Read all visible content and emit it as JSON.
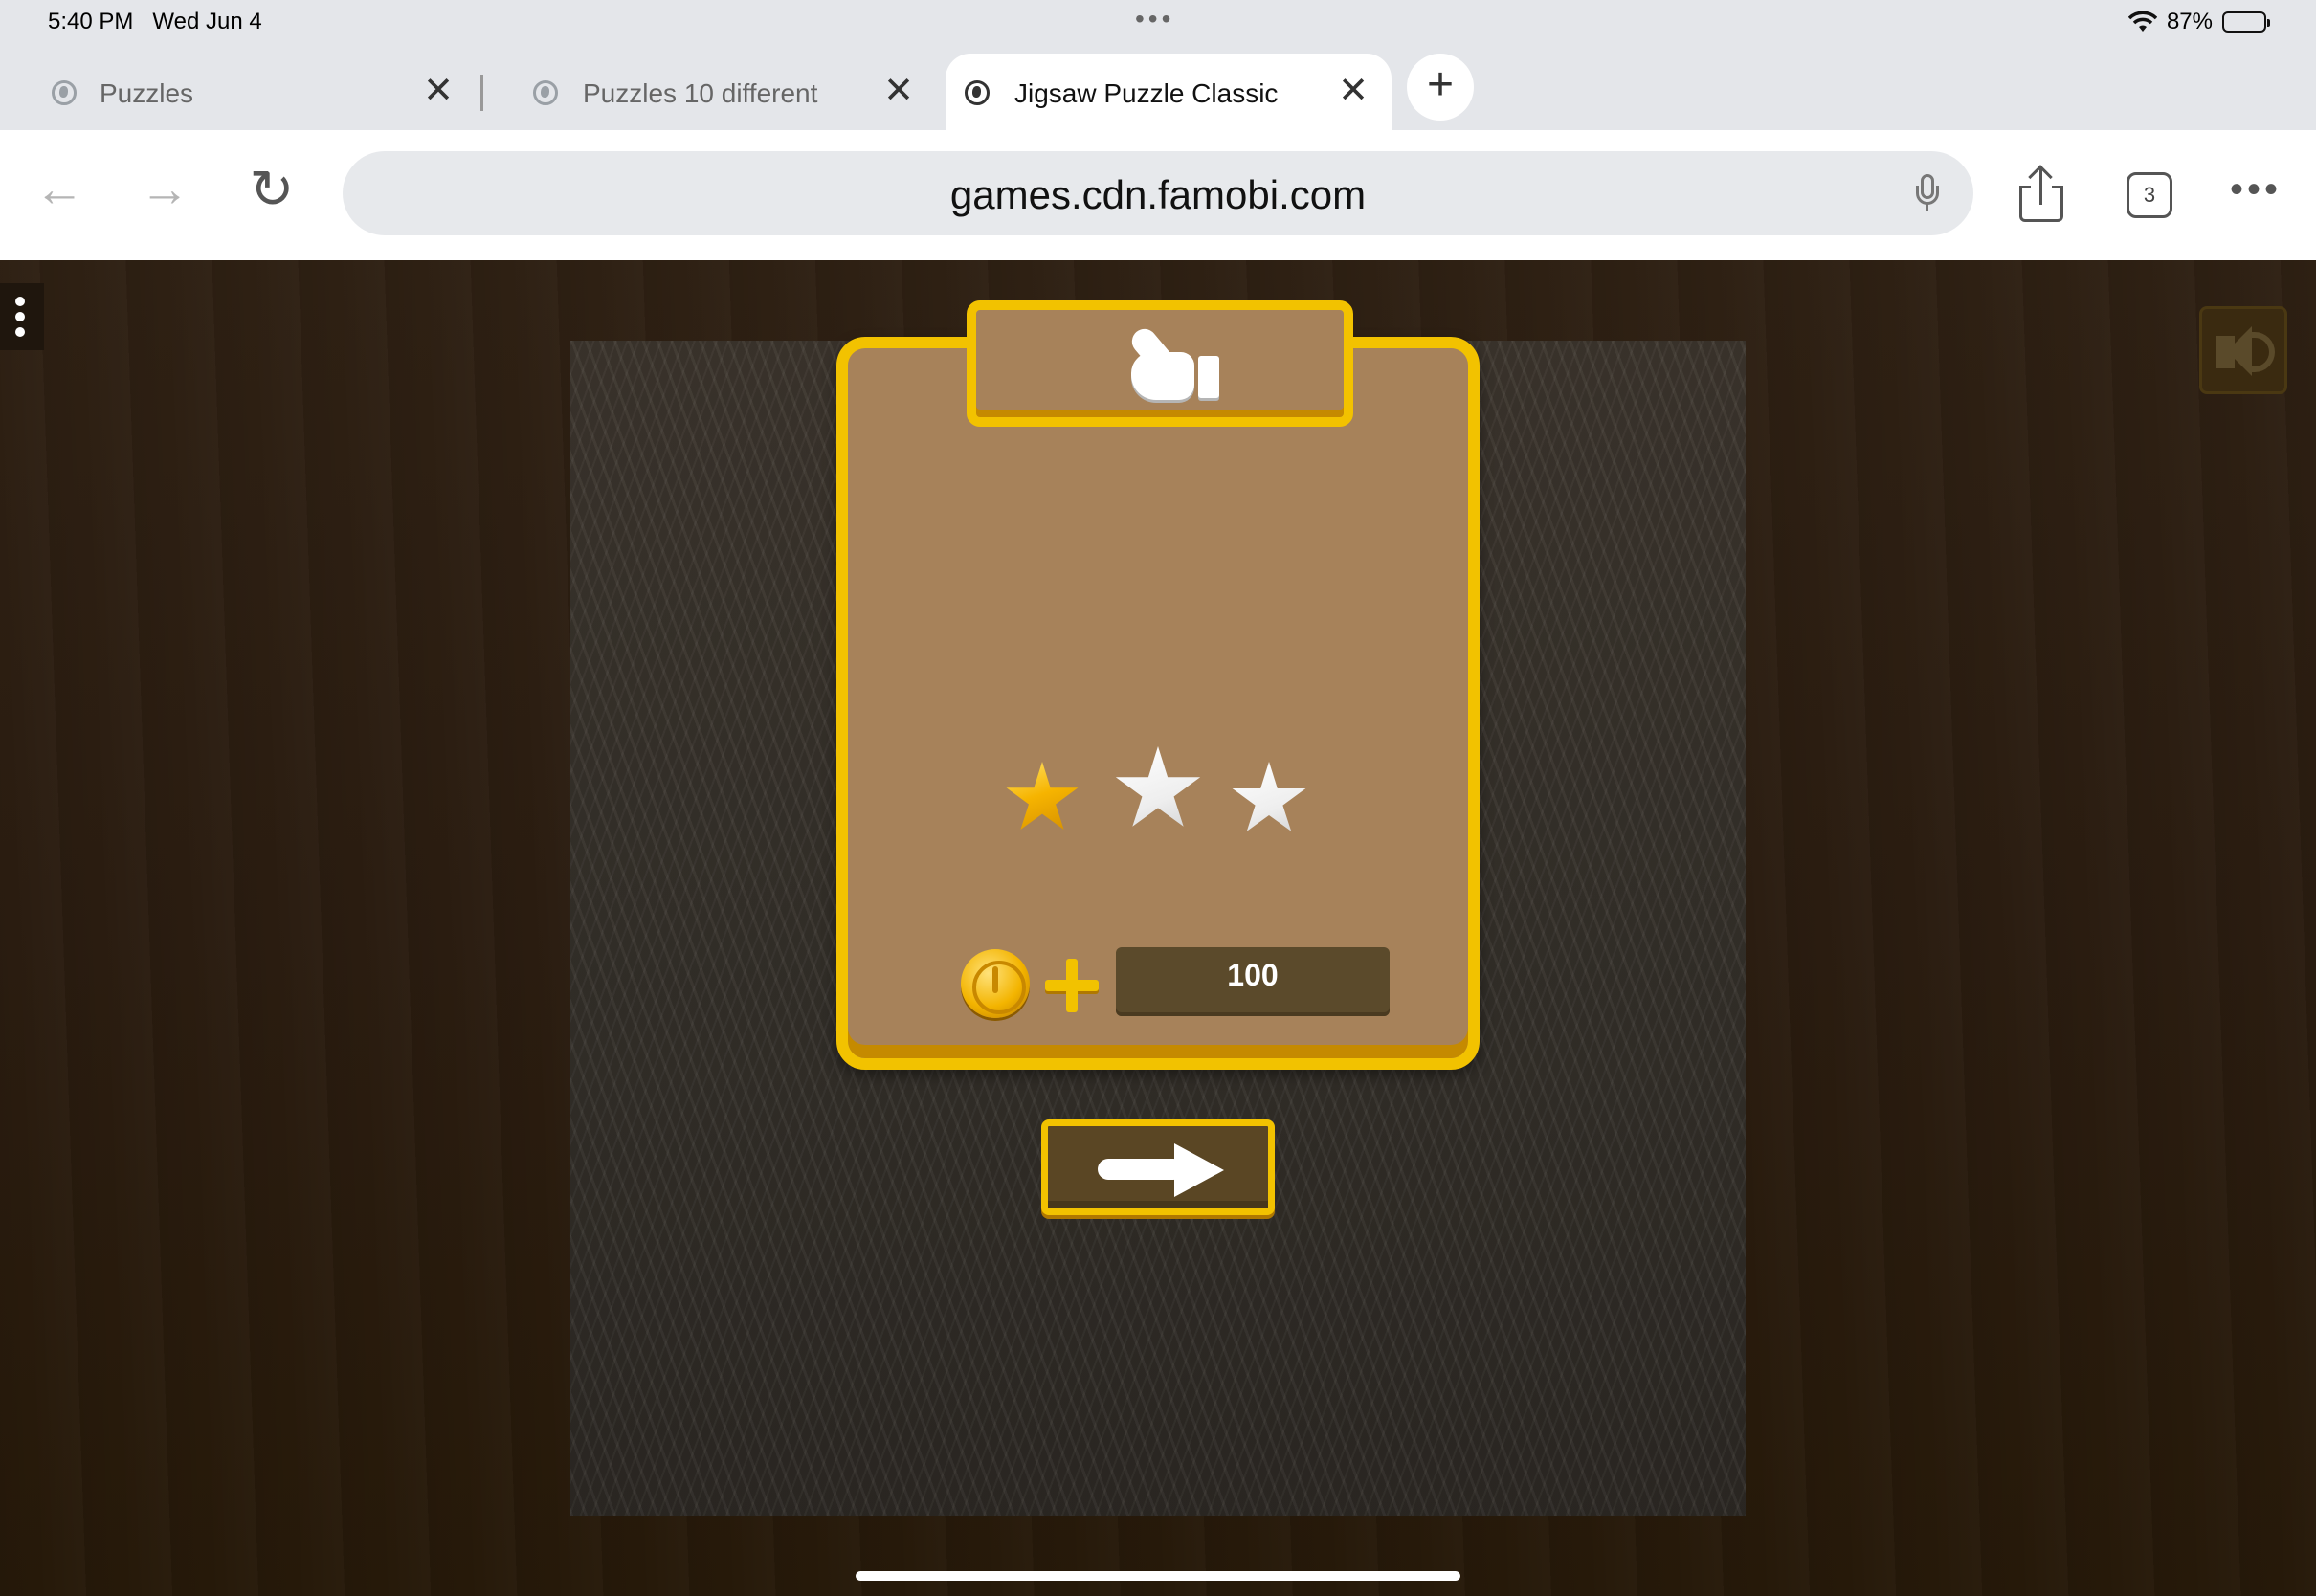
{
  "status_bar": {
    "time": "5:40 PM",
    "date": "Wed Jun 4",
    "battery": "87%",
    "battery_level": 0.87
  },
  "tabs": [
    {
      "title": "Puzzles",
      "active": false
    },
    {
      "title": "Puzzles 10 different",
      "active": false
    },
    {
      "title": "Jigsaw Puzzle Classic",
      "active": true
    }
  ],
  "address_bar": {
    "url": "games.cdn.famobi.com",
    "tab_count": "3"
  },
  "game": {
    "rating_stars": 1,
    "rating_max": 3,
    "coins_reward": "100"
  },
  "colors": {
    "dialog_border": "#f2c200",
    "dialog_fill": "#a7825a",
    "star_gold": "#f6b400"
  }
}
